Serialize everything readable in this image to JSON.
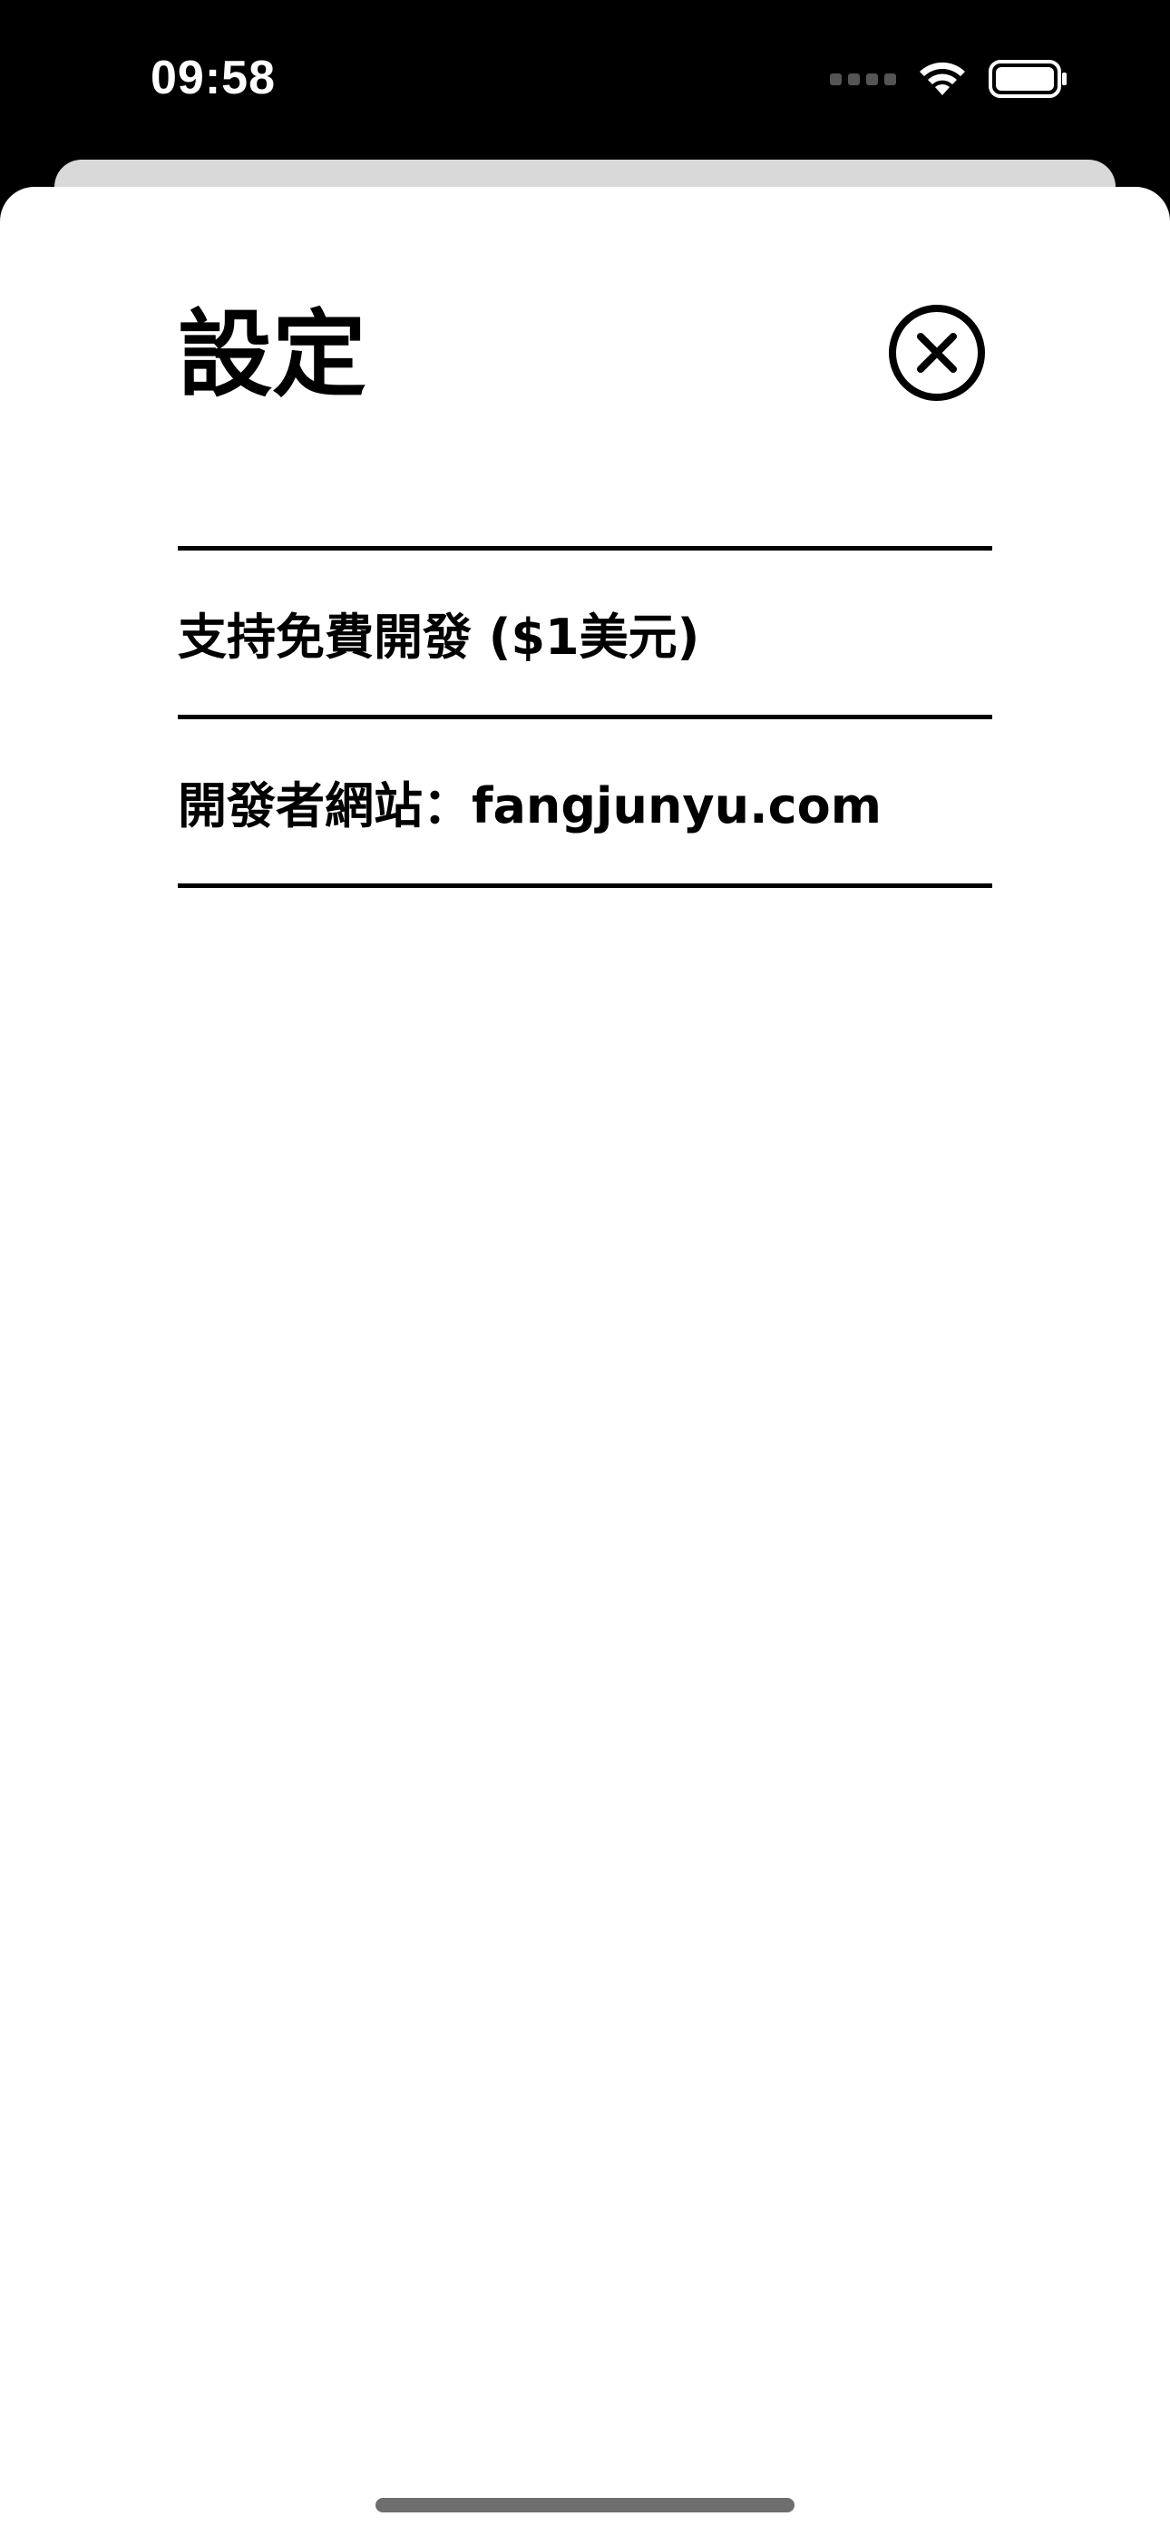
{
  "status_bar": {
    "time": "09:58",
    "icons": [
      "signal-icon",
      "wifi-icon",
      "battery-icon"
    ]
  },
  "sheet": {
    "title": "設定",
    "close_icon": "close-circle-icon",
    "items": [
      {
        "label": "支持免費開發 ($1美元)"
      },
      {
        "label": "開發者網站：fangjunyu.com"
      }
    ]
  },
  "colors": {
    "background": "#000000",
    "sheet": "#ffffff",
    "text": "#000000",
    "back_sheet": "#d9d9d9"
  }
}
